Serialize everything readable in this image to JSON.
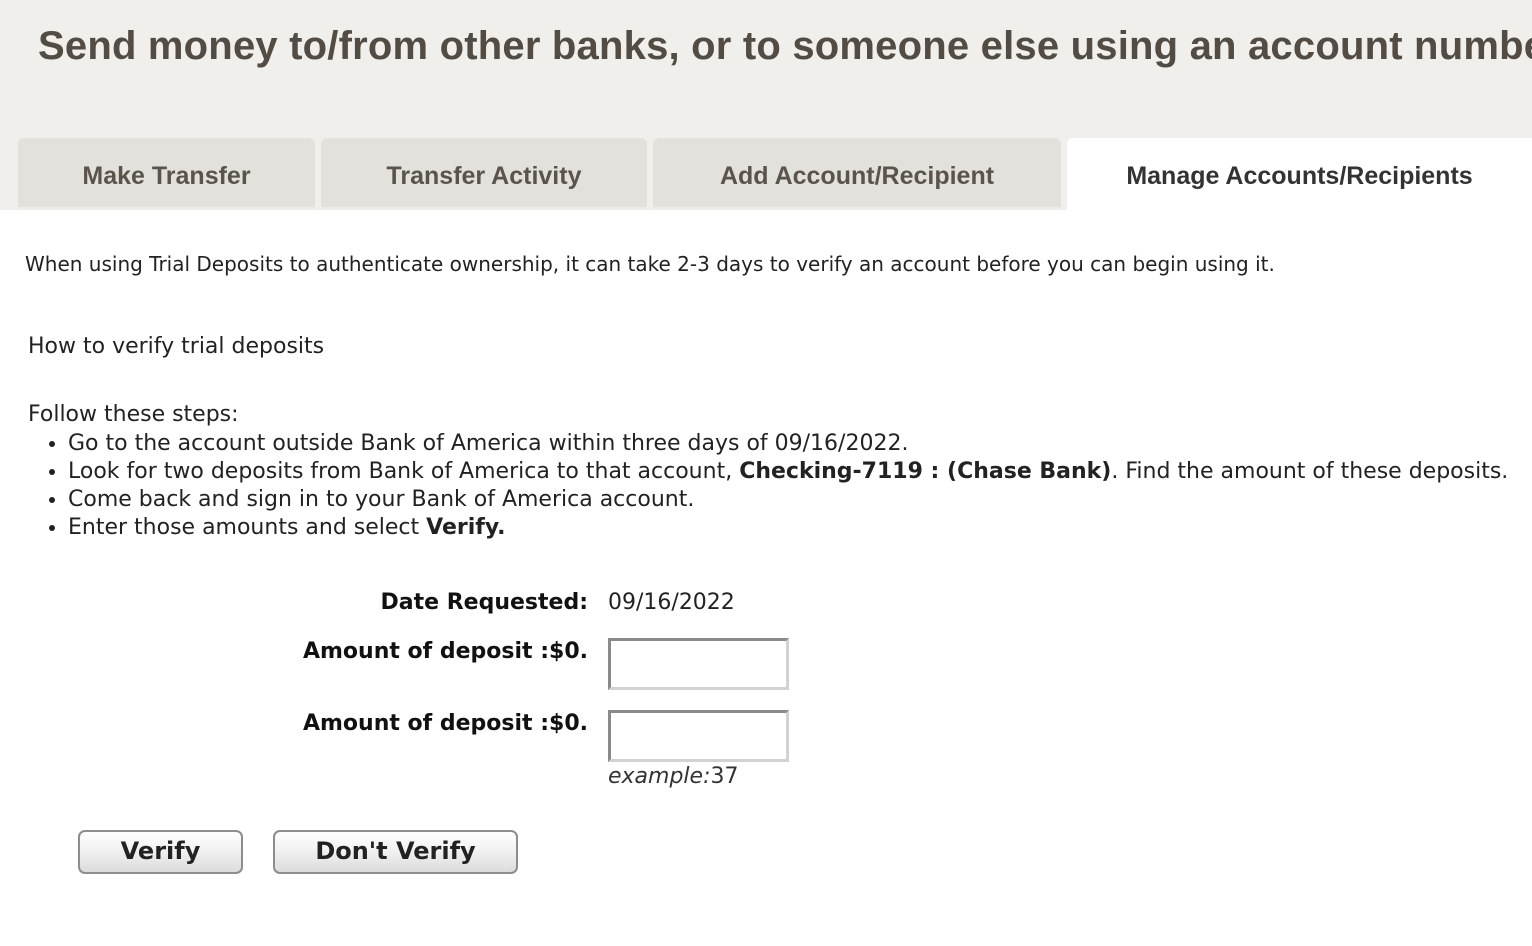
{
  "header": {
    "title": "Send money to/from other banks, or to someone else using an account number"
  },
  "tabs": [
    {
      "label": "Make Transfer",
      "active": false
    },
    {
      "label": "Transfer Activity",
      "active": false
    },
    {
      "label": "Add Account/Recipient",
      "active": false
    },
    {
      "label": "Manage Accounts/Recipients",
      "active": true
    }
  ],
  "main": {
    "info_text": "When using Trial Deposits to authenticate ownership, it can take 2-3 days to verify an account before you can begin using it.",
    "how_to_heading": "How to verify trial deposits",
    "steps_intro": "Follow these steps:",
    "steps": {
      "step1": "Go to the account outside Bank of America within three days of 09/16/2022.",
      "step2_pre": "Look for two deposits from Bank of America to that account, ",
      "step2_account": "Checking-7119 : (Chase Bank)",
      "step2_post": ". Find the amount of these deposits.",
      "step3": "Come back and sign in to your Bank of America account.",
      "step4_pre": "Enter those amounts and select ",
      "step4_action": "Verify."
    }
  },
  "form": {
    "date_label": "Date Requested:",
    "date_value": "09/16/2022",
    "amount1_label": "Amount of deposit :$0.",
    "amount1_value": "",
    "amount2_label": "Amount of deposit :$0.",
    "amount2_value": "",
    "example_label": "example:",
    "example_value": "37"
  },
  "buttons": {
    "verify": "Verify",
    "dont_verify": "Don't Verify"
  }
}
